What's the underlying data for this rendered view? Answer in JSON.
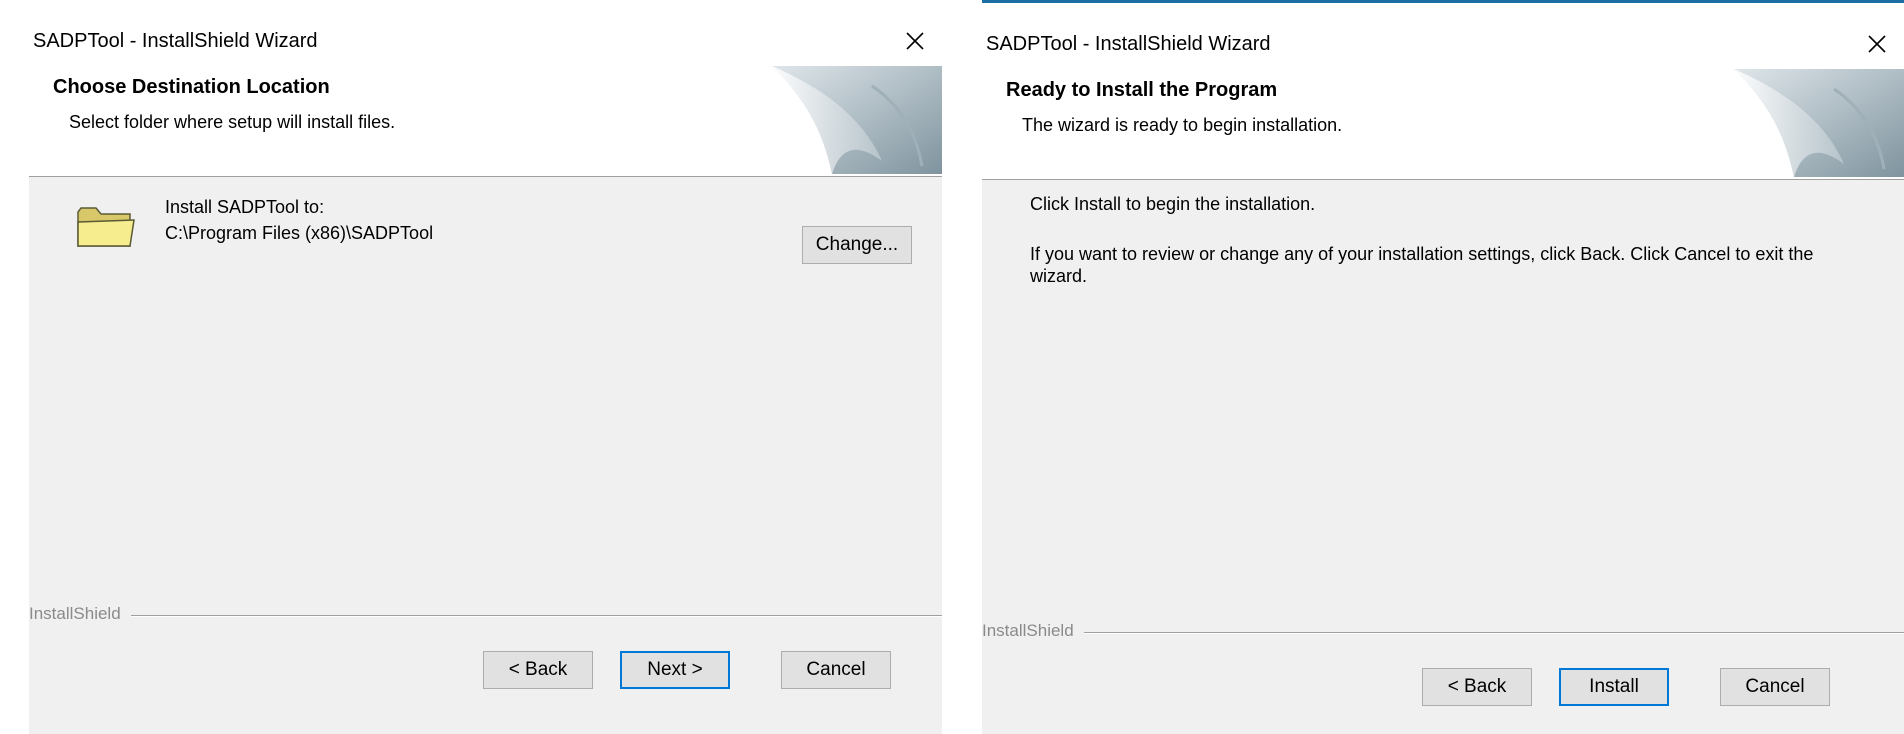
{
  "dialog1": {
    "title": "SADPTool - InstallShield Wizard",
    "header_title": "Choose Destination Location",
    "header_subtitle": "Select folder where setup will install files.",
    "install_label": "Install SADPTool to:",
    "install_path": "C:\\Program Files (x86)\\SADPTool",
    "change_label": "Change...",
    "brand": "InstallShield",
    "back_label": "< Back",
    "next_label": "Next >",
    "cancel_label": "Cancel"
  },
  "dialog2": {
    "title": "SADPTool - InstallShield Wizard",
    "header_title": "Ready to Install the Program",
    "header_subtitle": "The wizard is ready to begin installation.",
    "line1": "Click Install to begin the installation.",
    "line2": "If you want to review or change any of your installation settings, click Back. Click Cancel to exit the wizard.",
    "brand": "InstallShield",
    "back_label": "< Back",
    "install_label": "Install",
    "cancel_label": "Cancel"
  },
  "colors": {
    "accent": "#0078d7",
    "window_bg": "#f0f0f0",
    "header_bg": "#ffffff",
    "title_border": "#1c6ea4"
  },
  "icons": [
    "close-icon",
    "folder-icon",
    "wizard-banner-graphic"
  ]
}
